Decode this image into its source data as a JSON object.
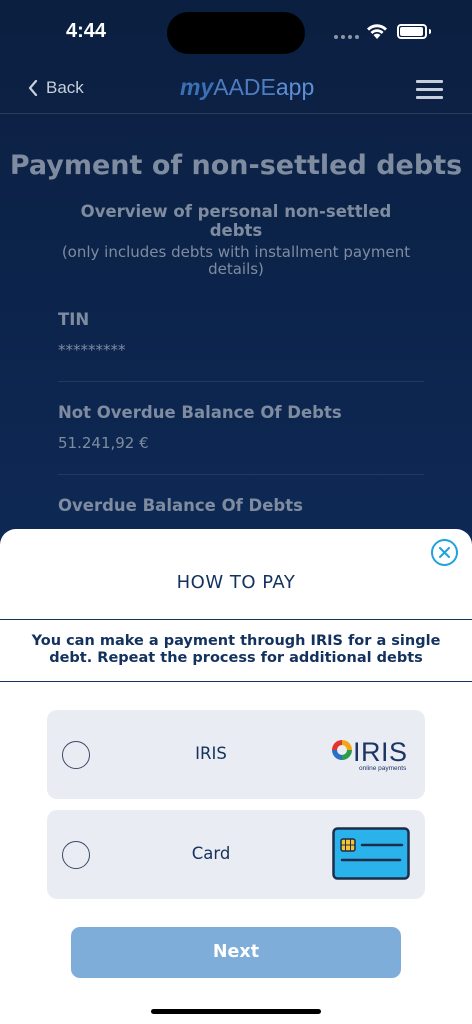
{
  "status_bar": {
    "time": "4:44"
  },
  "nav": {
    "back_label": "Back",
    "logo": {
      "my": "my",
      "aade": "AADE",
      "app": "app"
    }
  },
  "page": {
    "title": "Payment of non-settled debts",
    "overview_title": "Overview of personal non-settled debts",
    "overview_subtitle": "(only includes debts with installment payment details)",
    "fields": [
      {
        "label": "TIN",
        "value": "*********"
      },
      {
        "label": "Not Overdue Balance Of Debts",
        "value": "51.241,92 €"
      },
      {
        "label": "Overdue Balance Of Debts",
        "value": ""
      }
    ]
  },
  "sheet": {
    "title": "HOW TO PAY",
    "notice": "You can make a payment through IRIS for a single debt. Repeat the process for additional debts",
    "options": [
      {
        "label": "IRIS",
        "logo_text": "IRIS",
        "logo_subtext": "online payments",
        "selected": false
      },
      {
        "label": "Card",
        "selected": false
      }
    ],
    "next_label": "Next"
  },
  "colors": {
    "background_dark": "#0c2247",
    "primary_text": "#14325e",
    "accent": "#1ea3dd",
    "button_disabled": "#7fadd9",
    "option_bg": "#e9ecf3",
    "card_blue": "#29b3ea"
  }
}
